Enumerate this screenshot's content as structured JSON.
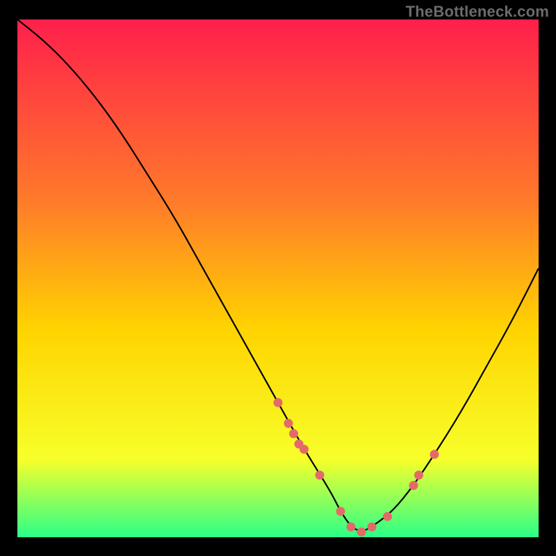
{
  "attribution": "TheBottleneck.com",
  "colors": {
    "gradient_top": "#ff1f4b",
    "gradient_mid1": "#ff7a2a",
    "gradient_mid2": "#ffd400",
    "gradient_mid3": "#f7ff2a",
    "gradient_bottom": "#2bff88",
    "curve": "#000000",
    "points": "#e46a6a",
    "frame": "#000000"
  },
  "chart_data": {
    "type": "line",
    "title": "",
    "xlabel": "",
    "ylabel": "",
    "xlim": [
      0,
      100
    ],
    "ylim": [
      0,
      100
    ],
    "series": [
      {
        "name": "bottleneck-curve",
        "x": [
          0,
          5,
          10,
          15,
          20,
          25,
          30,
          35,
          40,
          45,
          50,
          55,
          60,
          62,
          64,
          66,
          68,
          72,
          76,
          80,
          85,
          90,
          95,
          100
        ],
        "y": [
          100,
          96,
          91,
          85,
          78,
          70,
          62,
          53,
          44,
          35,
          26,
          17,
          9,
          5,
          2,
          1,
          2,
          5,
          10,
          16,
          24,
          33,
          42,
          52
        ]
      }
    ],
    "scatter_points": {
      "name": "highlighted-values",
      "x": [
        50,
        52,
        53,
        54,
        55,
        58,
        62,
        64,
        66,
        68,
        71,
        76,
        77,
        80
      ],
      "y": [
        26,
        22,
        20,
        18,
        17,
        12,
        5,
        2,
        1,
        2,
        4,
        10,
        12,
        16
      ]
    }
  }
}
